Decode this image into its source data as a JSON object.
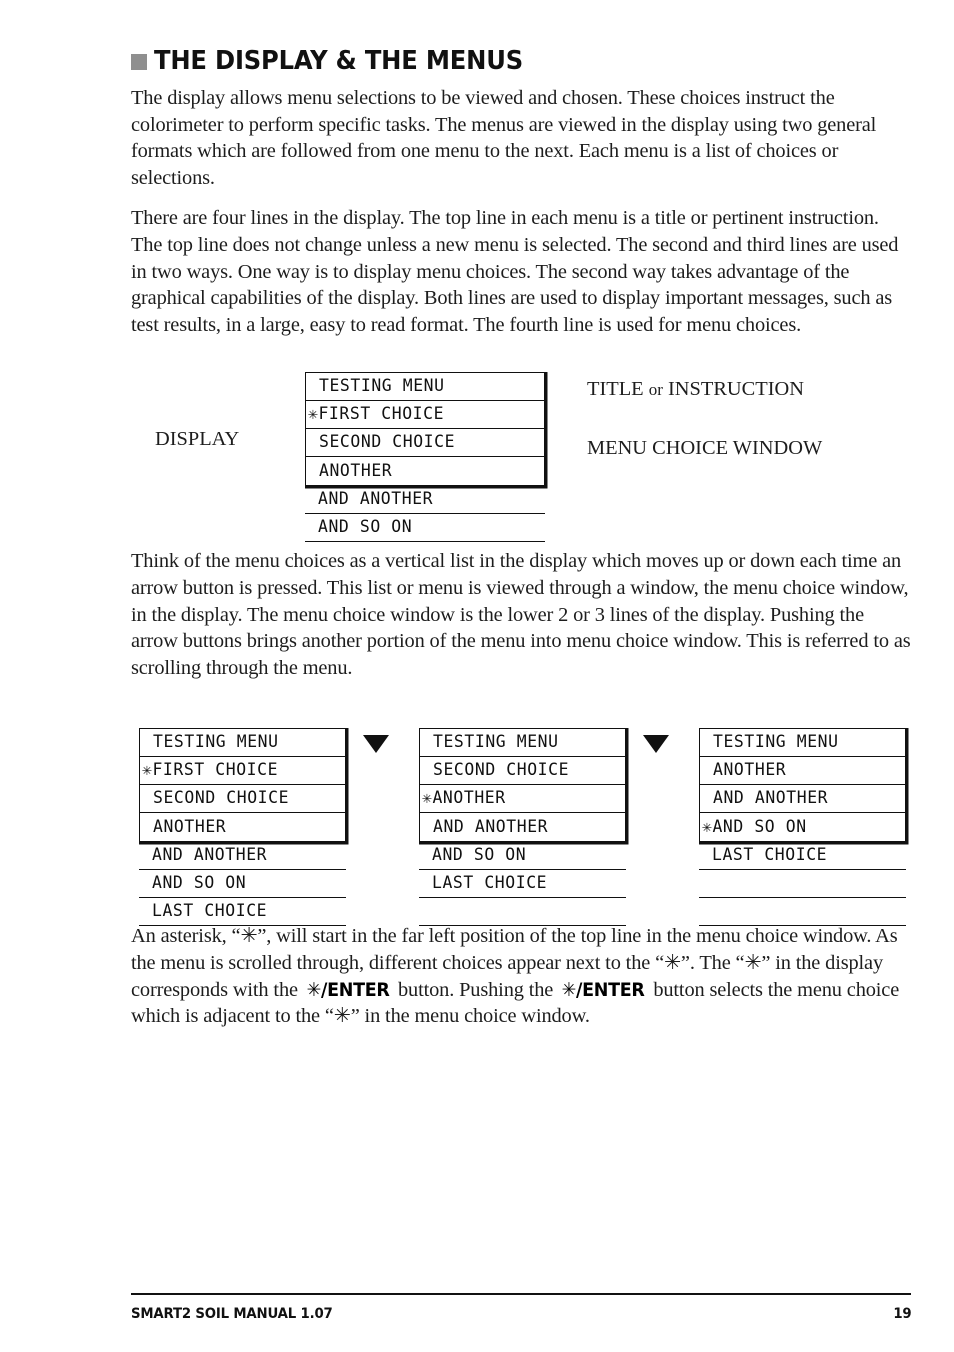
{
  "heading": {
    "bullet_color": "#8f8f8f",
    "text": "THE DISPLAY & THE MENUS"
  },
  "paragraphs": {
    "p1": "The display allows menu selections to be viewed and chosen. These choices instruct the colorimeter to perform specific tasks. The menus are viewed in the display using two general formats which are followed from one menu to the next. Each menu is a list of choices or selections.",
    "p2": "There are four lines in the display. The top line in each menu is a title or pertinent instruction. The top line does not change unless a new menu is selected. The second and third lines are used in two ways. One way is to display menu choices. The second way takes advantage of the graphical capabilities of the display. Both lines are used to display important messages, such as test results, in a large, easy to read format. The fourth line is used for menu choices.",
    "p3": "Think of the menu choices as a vertical list in the display which moves up or down each time an arrow button is pressed. This list or menu is viewed through a window, the menu choice window, in the display. The menu choice window is the lower 2 or 3 lines of the display. Pushing the arrow buttons brings another portion of the menu into menu choice window. This is referred to as scrolling through the menu.",
    "p4_a": "An asterisk, “✳”, will start in the far left position of the top line in the menu choice window. As the menu is scrolled through, different choices appear next to the “✳”. The “✳” in the display corresponds with the ",
    "p4_btn1": "✳/ENTER",
    "p4_b": " button. Pushing the ",
    "p4_btn2": "✳/ENTER",
    "p4_c": " button selects the menu choice which is adjacent to the “✳” in the menu choice window."
  },
  "figure1": {
    "display_label": "DISPLAY",
    "window_lines": [
      "TESTING MENU",
      "✳FIRST CHOICE",
      "SECOND CHOICE",
      "ANOTHER"
    ],
    "tail_lines": [
      "AND ANOTHER",
      "AND SO ON"
    ],
    "callout_title_a": "TITLE",
    "callout_title_or": "or",
    "callout_title_b": "INSTRUCTION",
    "callout_window": "MENU CHOICE WINDOW"
  },
  "figure2": {
    "arrow_icon": "triangle-down",
    "panels": [
      {
        "window_lines": [
          "TESTING MENU",
          "✳FIRST CHOICE",
          "SECOND CHOICE",
          "ANOTHER"
        ],
        "tail_lines": [
          "AND ANOTHER",
          "AND SO ON",
          "LAST CHOICE"
        ]
      },
      {
        "window_lines": [
          "TESTING MENU",
          "SECOND CHOICE",
          "✳ANOTHER",
          "AND ANOTHER"
        ],
        "tail_lines": [
          "AND SO ON",
          "LAST CHOICE",
          ""
        ]
      },
      {
        "window_lines": [
          "TESTING MENU",
          "ANOTHER",
          "AND ANOTHER",
          "✳AND SO ON"
        ],
        "tail_lines": [
          "LAST CHOICE",
          "",
          ""
        ]
      }
    ]
  },
  "footer": {
    "title": "SMART2 SOIL MANUAL 1.07",
    "page_number": "19"
  }
}
